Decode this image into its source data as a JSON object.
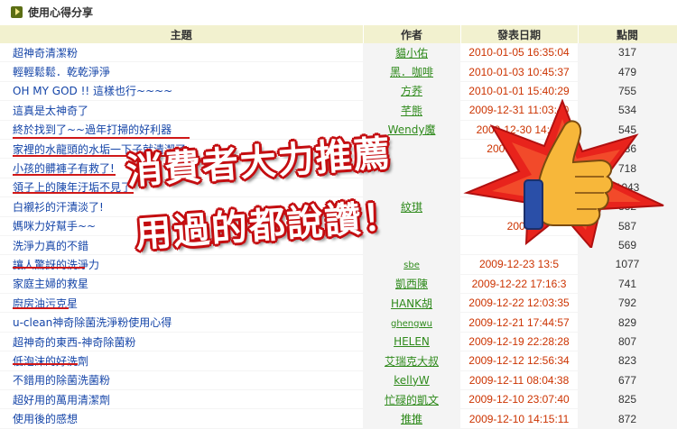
{
  "section": {
    "title": "使用心得分享",
    "icon": "arrow-right-icon"
  },
  "table": {
    "headers": [
      "主題",
      "作者",
      "發表日期",
      "點閱"
    ],
    "rows": [
      {
        "subject": "超神奇清潔粉",
        "author": "貓小佑",
        "date": "2010-01-05 16:35:04",
        "views": "317"
      },
      {
        "subject": "輕輕鬆鬆．乾乾淨淨",
        "author": "黑．咖啡",
        "date": "2010-01-03 10:45:37",
        "views": "479"
      },
      {
        "subject": "OH MY GOD !! 這樣也行~~~~",
        "author": "方荞",
        "date": "2010-01-01 15:40:29",
        "views": "755"
      },
      {
        "subject": "這真是太神奇了",
        "author": "芊熊",
        "date": "2009-12-31 11:03:40",
        "views": "534"
      },
      {
        "subject": "終於找到了~~過年打掃的好利器",
        "author": "Wendy魔",
        "date": "2009-12-30 14:43",
        "views": "545"
      },
      {
        "subject": "家裡的水龍頭的水垢一下子就清潔了",
        "author": "",
        "date": "2009-12-30 0",
        "views": "586"
      },
      {
        "subject": "小孩的髒褲子有救了!",
        "author": "",
        "date": "",
        "views": "718"
      },
      {
        "subject": "領子上的陳年汙垢不見了",
        "author": "",
        "date": "2009",
        "views": "1043"
      },
      {
        "subject": "白襯衫的汗漬淡了!",
        "author": "紋琪",
        "date": "",
        "views": "882"
      },
      {
        "subject": "媽咪力好幫手~~",
        "author": "",
        "date": "2009",
        "views": "587"
      },
      {
        "subject": "洗淨力真的不錯",
        "author": "",
        "date": "",
        "views": "569"
      },
      {
        "subject": "讓人驚訝的洗淨力",
        "author": "sbe",
        "date": "2009-12-23 13:5",
        "views": "1077"
      },
      {
        "subject": "家庭主婦的救星",
        "author": "凱西陳",
        "date": "2009-12-22 17:16:3",
        "views": "741"
      },
      {
        "subject": "廚房油污克星",
        "author": "HANK胡",
        "date": "2009-12-22 12:03:35",
        "views": "792"
      },
      {
        "subject": "u-clean神奇除菌洗淨粉使用心得",
        "author": "ghengwu",
        "date": "2009-12-21 17:44:57",
        "views": "829"
      },
      {
        "subject": "超神奇的東西-神奇除菌粉",
        "author": "HELEN",
        "date": "2009-12-19 22:28:28",
        "views": "807"
      },
      {
        "subject": "低泡沫的好洗劑",
        "author": "艾瑞克大叔",
        "date": "2009-12-12 12:56:34",
        "views": "823"
      },
      {
        "subject": "不錯用的除菌洗菌粉",
        "author": "kellyW",
        "date": "2009-12-11 08:04:38",
        "views": "677"
      },
      {
        "subject": "超好用的萬用清潔劑",
        "author": "忙碌的凱文",
        "date": "2009-12-10 23:07:40",
        "views": "825"
      },
      {
        "subject": "使用後的感想",
        "author": "推推",
        "date": "2009-12-10 14:15:11",
        "views": "872"
      }
    ]
  },
  "promo": {
    "line1": "消費者大力推薦",
    "line2": "用過的都說讚！",
    "graphic": "thumbs-up-star-icon",
    "text_color": "#ffffff",
    "outline_color": "#c40d10",
    "star_color": "#e8231c"
  },
  "colors": {
    "header_bg": "#f2f1cf",
    "subject_link": "#1545a8",
    "author_link": "#2f8a1c",
    "date_text": "#cc3300",
    "underline": "#d01818"
  }
}
